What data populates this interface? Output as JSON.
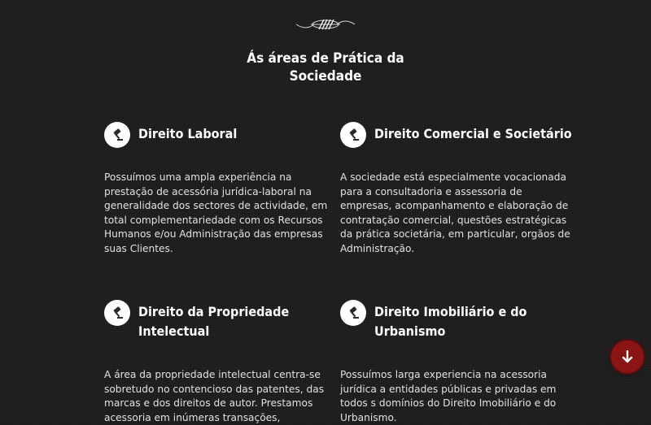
{
  "section": {
    "title_lines": [
      "Ás áreas de Prática da",
      "Sociedade"
    ]
  },
  "areas": [
    {
      "icon": "gavel-icon",
      "title_lines": [
        "Direito Laboral"
      ],
      "text_lines": [
        "Possuímos uma ampla experiência na",
        "prestação de acessória jurídica-laboral na",
        "generalidade dos sectores de actividade, em",
        "total complementariedade com os Recursos",
        "Humanos e/ou Administração das empresas",
        "suas Clientes."
      ]
    },
    {
      "icon": "gavel-icon",
      "title_lines": [
        "Direito Comercial e Societário"
      ],
      "text_lines": [
        "A sociedade está especialmente vocacionada",
        "para a consultadoria e assessoria de",
        "empresas, acompanhamento e elaboração de",
        "contratação comercial, questões estratégicas",
        "da prática societária, em particular, orgãos de",
        "Administração."
      ]
    },
    {
      "icon": "gavel-icon",
      "title_lines": [
        "Direito da Propriedade",
        "Intelectual"
      ],
      "text_lines": [
        "A área da propriedade intelectual centra-se",
        "sobretudo no contencioso das patentes, das",
        "marcas e dos direitos de autor. Prestamos",
        "acessoria em inúmeras transações,"
      ]
    },
    {
      "icon": "gavel-icon",
      "title_lines": [
        "Direito Imobiliário e do",
        "Urbanismo"
      ],
      "text_lines": [
        "Possuímos larga experiencia na acessoria",
        "jurídica a entidades públicas e privadas em",
        "todos s domínios do Direito Imobiliário e do",
        "Urbanismo."
      ]
    }
  ],
  "scroll_button": {
    "icon": "arrow-down-icon",
    "color": "#8b1515"
  },
  "ornament": {
    "icon": "flourish-ornament-icon"
  }
}
